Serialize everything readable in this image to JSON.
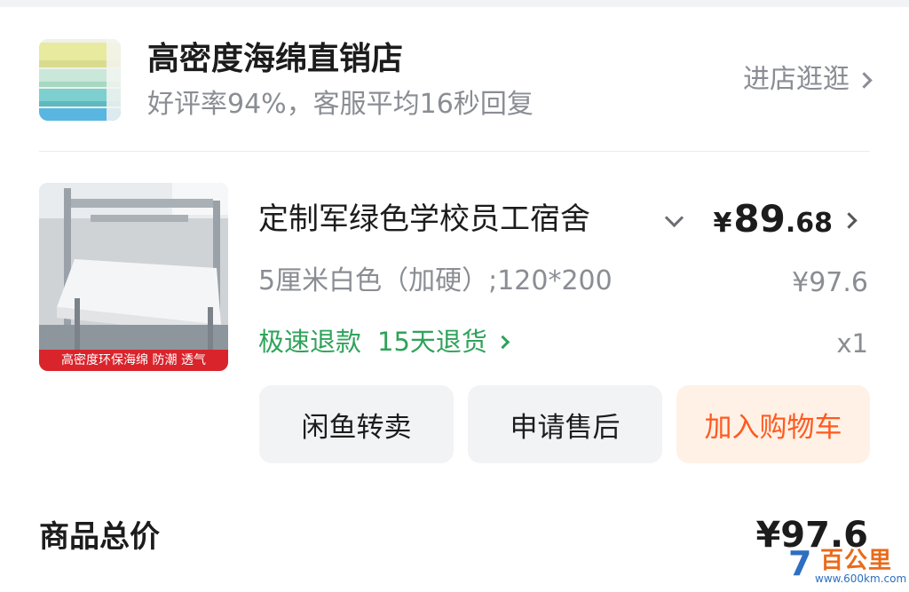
{
  "store": {
    "name": "高密度海绵直销店",
    "subtitle": "好评率94%，客服平均16秒回复",
    "visit_label": "进店逛逛"
  },
  "product": {
    "title": "定制军绿色学校员工宿舍",
    "thumb_banner": "高密度环保海绵 防潮 透气",
    "price_currency": "¥",
    "price_integer": "89",
    "price_decimal": ".68",
    "original_price": "¥97.6",
    "sku": "5厘米白色（加硬）;120*200",
    "service_refund": "极速退款",
    "service_return": "15天退货",
    "quantity": "x1"
  },
  "actions": {
    "resell_label": "闲鱼转卖",
    "after_sale_label": "申请售后",
    "add_cart_label": "加入购物车"
  },
  "summary": {
    "total_label": "商品总价",
    "total_value": "¥97.6"
  },
  "watermark": {
    "seven": "7",
    "text": "百公里",
    "url": "www.600km.com"
  },
  "colors": {
    "accent_orange": "#ff5a1f",
    "service_green": "#2fa35a",
    "muted_text": "#8a8d93"
  }
}
